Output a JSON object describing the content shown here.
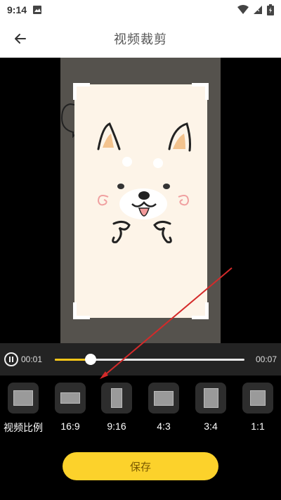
{
  "status_bar": {
    "time": "9:14"
  },
  "app_bar": {
    "title": "视频裁剪"
  },
  "player": {
    "current_time": "00:01",
    "total_time": "00:07",
    "progress": 0.19
  },
  "ratio_options": [
    {
      "label": "视频比例",
      "icon": "original-ratio-icon"
    },
    {
      "label": "16:9",
      "icon": "ratio-16-9-icon"
    },
    {
      "label": "9:16",
      "icon": "ratio-9-16-icon"
    },
    {
      "label": "4:3",
      "icon": "ratio-4-3-icon"
    },
    {
      "label": "3:4",
      "icon": "ratio-3-4-icon"
    },
    {
      "label": "1:1",
      "icon": "ratio-1-1-icon"
    }
  ],
  "save_button": {
    "label": "保存"
  },
  "colors": {
    "accent": "#fcd22b",
    "progress": "#f5c518",
    "background": "#000000"
  }
}
